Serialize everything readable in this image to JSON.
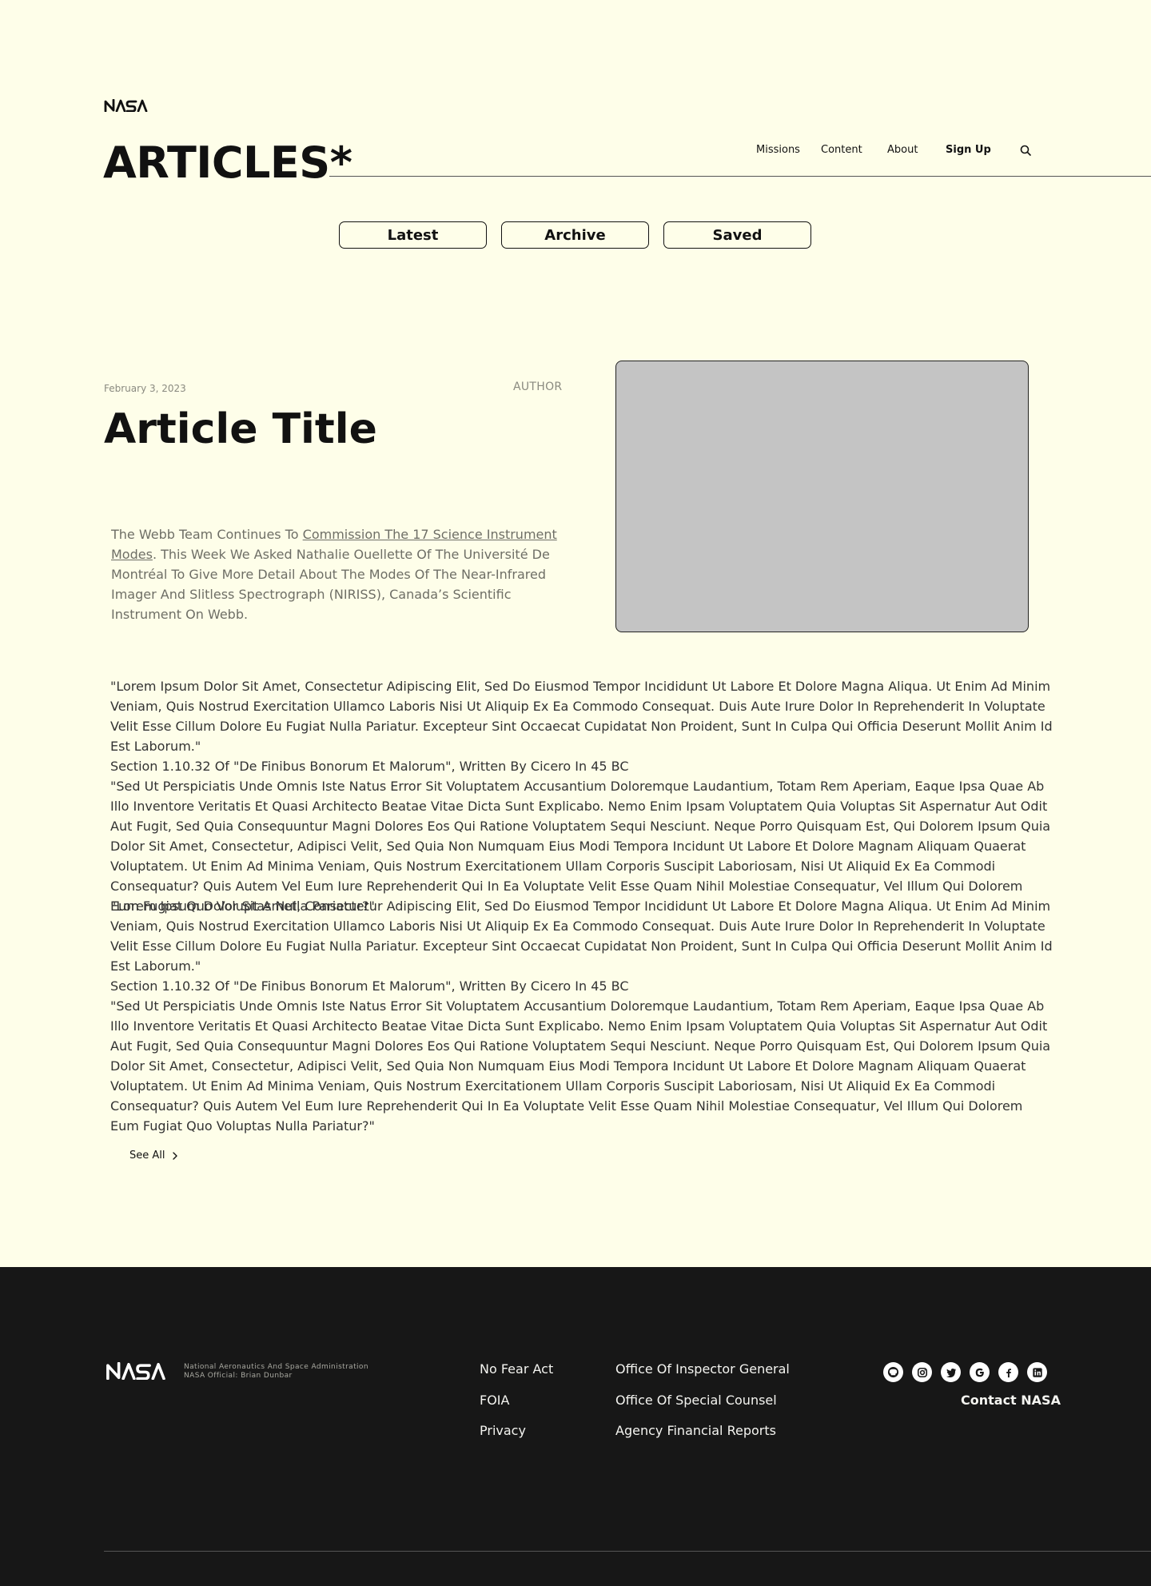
{
  "header": {
    "logo_text": "NASA",
    "page_title": "ARTICLES*",
    "nav": [
      "Missions",
      "Content",
      "About",
      "Sign Up"
    ]
  },
  "tabs": [
    "Latest",
    "Archive",
    "Saved"
  ],
  "article": {
    "date": "February 3, 2023",
    "author": "AUTHOR",
    "title": "Article Title",
    "intro_before": "The Webb Team Continues To ",
    "intro_link": "Commission The 17 Science Instrument Modes",
    "intro_after": ". This Week We Asked Nathalie Ouellette Of The Université De Montréal To Give More Detail About The Modes Of The Near-Infrared Imager And Slitless Spectrograph (NIRISS), Canada’s Scientific Instrument On Webb.",
    "body": [
      {
        "p1": "\"Lorem Ipsum Dolor Sit Amet, Consectetur Adipiscing Elit, Sed Do Eiusmod Tempor Incididunt Ut Labore Et Dolore Magna Aliqua. Ut Enim Ad Minim Veniam, Quis Nostrud Exercitation Ullamco Laboris Nisi Ut Aliquip Ex Ea Commodo Consequat. Duis Aute Irure Dolor In Reprehenderit In Voluptate Velit Esse Cillum Dolore Eu Fugiat Nulla Pariatur. Excepteur Sint Occaecat Cupidatat Non Proident, Sunt In Culpa Qui Officia Deserunt Mollit Anim Id Est Laborum.\"",
        "p2": "Section 1.10.32 Of \"De Finibus Bonorum Et Malorum\", Written By Cicero In 45 BC",
        "p3": "\"Sed Ut Perspiciatis Unde Omnis Iste Natus Error Sit Voluptatem Accusantium Doloremque Laudantium, Totam Rem Aperiam, Eaque Ipsa Quae Ab Illo Inventore Veritatis Et Quasi Architecto Beatae Vitae Dicta Sunt Explicabo. Nemo Enim Ipsam Voluptatem Quia Voluptas Sit Aspernatur Aut Odit Aut Fugit, Sed Quia Consequuntur Magni Dolores Eos Qui Ratione Voluptatem Sequi Nesciunt. Neque Porro Quisquam Est, Qui Dolorem Ipsum Quia Dolor Sit Amet, Consectetur, Adipisci Velit, Sed Quia Non Numquam Eius Modi Tempora Incidunt Ut Labore Et Dolore Magnam Aliquam Quaerat Voluptatem. Ut Enim Ad Minima Veniam, Quis Nostrum Exercitationem Ullam Corporis Suscipit Laboriosam, Nisi Ut Aliquid Ex Ea Commodi Consequatur? Quis Autem Vel Eum Iure Reprehenderit Qui In Ea Voluptate Velit Esse Quam Nihil Molestiae Consequatur, Vel Illum Qui Dolorem Eum Fugiat Quo Voluptas Nulla Pariatur?\""
      },
      {
        "p1": "\"Lorem Ipsum Dolor Sit Amet, Consectetur Adipiscing Elit, Sed Do Eiusmod Tempor Incididunt Ut Labore Et Dolore Magna Aliqua. Ut Enim Ad Minim Veniam, Quis Nostrud Exercitation Ullamco Laboris Nisi Ut Aliquip Ex Ea Commodo Consequat. Duis Aute Irure Dolor In Reprehenderit In Voluptate Velit Esse Cillum Dolore Eu Fugiat Nulla Pariatur. Excepteur Sint Occaecat Cupidatat Non Proident, Sunt In Culpa Qui Officia Deserunt Mollit Anim Id Est Laborum.\"",
        "p2": "Section 1.10.32 Of \"De Finibus Bonorum Et Malorum\", Written By Cicero In 45 BC",
        "p3": "\"Sed Ut Perspiciatis Unde Omnis Iste Natus Error Sit Voluptatem Accusantium Doloremque Laudantium, Totam Rem Aperiam, Eaque Ipsa Quae Ab Illo Inventore Veritatis Et Quasi Architecto Beatae Vitae Dicta Sunt Explicabo. Nemo Enim Ipsam Voluptatem Quia Voluptas Sit Aspernatur Aut Odit Aut Fugit, Sed Quia Consequuntur Magni Dolores Eos Qui Ratione Voluptatem Sequi Nesciunt. Neque Porro Quisquam Est, Qui Dolorem Ipsum Quia Dolor Sit Amet, Consectetur, Adipisci Velit, Sed Quia Non Numquam Eius Modi Tempora Incidunt Ut Labore Et Dolore Magnam Aliquam Quaerat Voluptatem. Ut Enim Ad Minima Veniam, Quis Nostrum Exercitationem Ullam Corporis Suscipit Laboriosam, Nisi Ut Aliquid Ex Ea Commodi Consequatur? Quis Autem Vel Eum Iure Reprehenderit Qui In Ea Voluptate Velit Esse Quam Nihil Molestiae Consequatur, Vel Illum Qui Dolorem Eum Fugiat Quo Voluptas Nulla Pariatur?\""
      }
    ],
    "see_all": "See All"
  },
  "footer": {
    "logo_text": "NASA",
    "tagline_1": "National Aeronautics And Space Administration",
    "tagline_2": "NASA Official: Brian Dunbar",
    "col1": [
      "No Fear Act",
      "FOIA",
      "Privacy"
    ],
    "col2": [
      "Office Of Inspector General",
      "Office Of Special Counsel",
      "Agency Financial Reports"
    ],
    "social_icons": [
      "github-icon",
      "instagram-icon",
      "twitter-icon",
      "google-icon",
      "facebook-icon",
      "linkedin-icon"
    ],
    "contact": "Contact NASA"
  },
  "colors": {
    "background": "#fefee9",
    "footer_background": "#171717",
    "image_placeholder": "#c4c4c4"
  }
}
